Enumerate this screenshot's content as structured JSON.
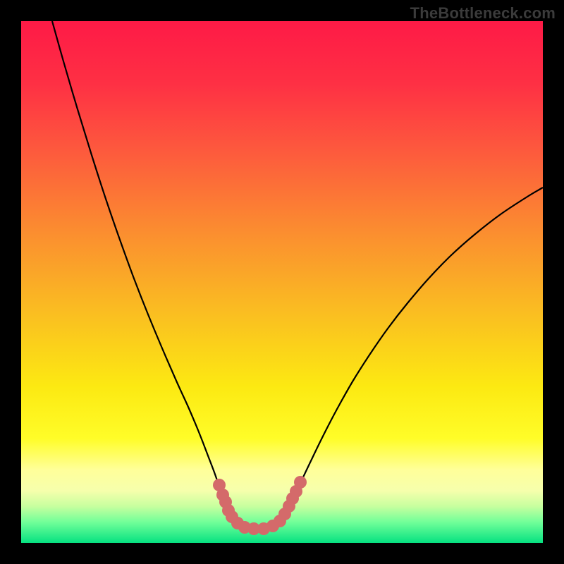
{
  "watermark": "TheBottleneck.com",
  "gradient_stops": [
    {
      "offset": 0.0,
      "color": "#fe1a46"
    },
    {
      "offset": 0.12,
      "color": "#fe3044"
    },
    {
      "offset": 0.25,
      "color": "#fd5a3d"
    },
    {
      "offset": 0.4,
      "color": "#fb8c30"
    },
    {
      "offset": 0.55,
      "color": "#fabb22"
    },
    {
      "offset": 0.7,
      "color": "#fce912"
    },
    {
      "offset": 0.8,
      "color": "#fffd28"
    },
    {
      "offset": 0.86,
      "color": "#ffff9a"
    },
    {
      "offset": 0.9,
      "color": "#f6ffac"
    },
    {
      "offset": 0.93,
      "color": "#c7ff9f"
    },
    {
      "offset": 0.96,
      "color": "#72ff99"
    },
    {
      "offset": 1.0,
      "color": "#06e281"
    }
  ],
  "marker_color": "#d46a6a",
  "marker_radius": 9,
  "chart_data": {
    "type": "line",
    "title": "",
    "xlabel": "",
    "ylabel": "",
    "xrange": [
      0,
      740
    ],
    "yrange": [
      0,
      740
    ],
    "grid": false,
    "series": [
      {
        "name": "bottleneck-curve",
        "points": [
          [
            44,
            0
          ],
          [
            60,
            57
          ],
          [
            80,
            125
          ],
          [
            100,
            190
          ],
          [
            120,
            252
          ],
          [
            140,
            310
          ],
          [
            160,
            365
          ],
          [
            180,
            416
          ],
          [
            200,
            464
          ],
          [
            220,
            510
          ],
          [
            236,
            545
          ],
          [
            248,
            573
          ],
          [
            258,
            598
          ],
          [
            266,
            619
          ],
          [
            274,
            640
          ],
          [
            280,
            657
          ],
          [
            285,
            670
          ],
          [
            290,
            683
          ],
          [
            295,
            694
          ],
          [
            300,
            702
          ],
          [
            306,
            710
          ],
          [
            314,
            716
          ],
          [
            324,
            719
          ],
          [
            336,
            720
          ],
          [
            348,
            719
          ],
          [
            358,
            716
          ],
          [
            366,
            710
          ],
          [
            372,
            702
          ],
          [
            378,
            692
          ],
          [
            384,
            680
          ],
          [
            390,
            668
          ],
          [
            398,
            651
          ],
          [
            408,
            630
          ],
          [
            420,
            605
          ],
          [
            435,
            575
          ],
          [
            452,
            543
          ],
          [
            472,
            508
          ],
          [
            495,
            472
          ],
          [
            520,
            436
          ],
          [
            548,
            400
          ],
          [
            578,
            365
          ],
          [
            610,
            332
          ],
          [
            644,
            302
          ],
          [
            680,
            274
          ],
          [
            718,
            249
          ],
          [
            740,
            236
          ]
        ]
      }
    ],
    "markers": [
      [
        281,
        658
      ],
      [
        286,
        672
      ],
      [
        290,
        682
      ],
      [
        294,
        694
      ],
      [
        299,
        703
      ],
      [
        307,
        712
      ],
      [
        317,
        718
      ],
      [
        330,
        720
      ],
      [
        344,
        720
      ],
      [
        357,
        716
      ],
      [
        367,
        709
      ],
      [
        374,
        699
      ],
      [
        380,
        688
      ],
      [
        385,
        677
      ],
      [
        390,
        667
      ],
      [
        396,
        654
      ]
    ]
  }
}
